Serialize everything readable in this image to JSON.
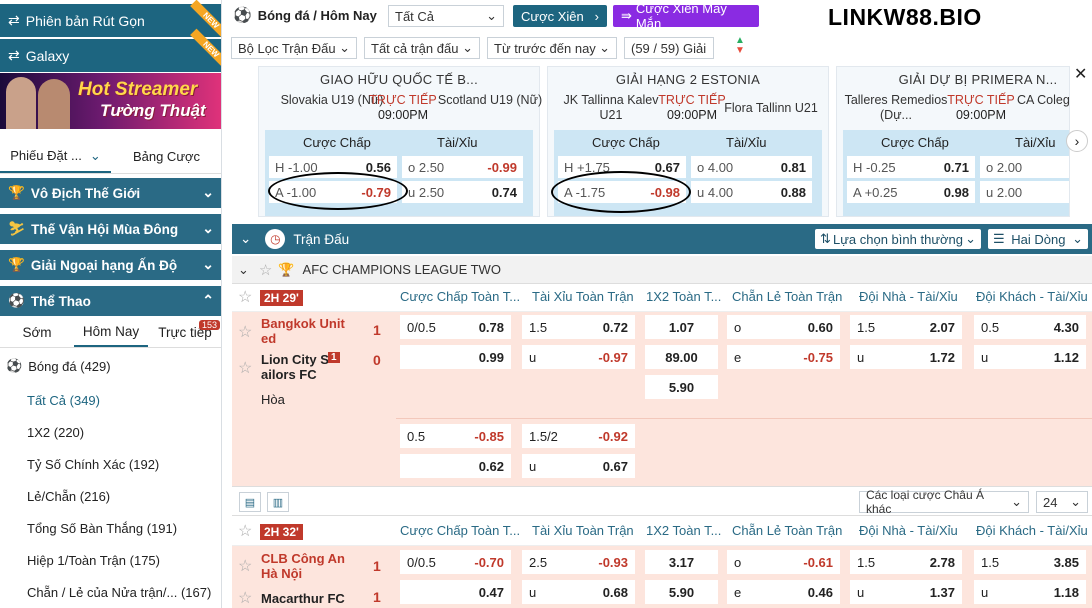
{
  "sidebar": {
    "collapsed_version": "Phiên bản Rút Gọn",
    "galaxy": "Galaxy",
    "new_tag": "NEW",
    "banner_line1": "Hot Streamer",
    "banner_line2": "Tường Thuật",
    "tab_slip": "Phiếu Đặt ...",
    "tab_table": "Bảng Cược",
    "categories": [
      {
        "label": "Vô Địch Thế Giới"
      },
      {
        "label": "Thế Vận Hội Mùa Đông"
      },
      {
        "label": "Giải Ngoại hạng Ấn Độ"
      },
      {
        "label": "Thể Thao"
      }
    ],
    "subtabs": [
      "Sớm",
      "Hôm Nay",
      "Trực tiếp"
    ],
    "live_count": "153",
    "sports": [
      {
        "label": "Bóng đá",
        "count": "(429)"
      },
      {
        "label": "Tất Cả",
        "count": "(349)"
      },
      {
        "label": "1X2",
        "count": "(220)"
      },
      {
        "label": "Tỷ Số Chính Xác",
        "count": "(192)"
      },
      {
        "label": "Lẻ/Chẵn",
        "count": "(216)"
      },
      {
        "label": "Tổng Số Bàn Thắng",
        "count": "(191)"
      },
      {
        "label": "Hiệp 1/Toàn Trận",
        "count": "(175)"
      },
      {
        "label": "Chẵn / Lẻ của Nửa trận/...",
        "count": "(167)"
      }
    ]
  },
  "toolbar": {
    "breadcrumb": "Bóng đá / Hôm Nay",
    "filter_all": "Tất Cả",
    "parlay": "Cược Xiên",
    "lucky_parlay": "Cược Xiên May Mắn",
    "brand": "LINKW88.BIO",
    "league_filter": "Bộ Lọc Trận Đấu",
    "all_matches": "Tất cả trận đấu",
    "time_filter": "Từ trước đến nay",
    "league_count": "(59 / 59) Giải"
  },
  "cards": [
    {
      "league": "GIAO HỮU QUỐC TẾ B...",
      "home": "Slovakia U19 (Nữ)",
      "away": "Scotland U19 (Nữ)",
      "live": "TRỰC TIẾP",
      "time": "09:00PM",
      "h_line": "-1.00",
      "h_odds": "0.56",
      "a_line": "-1.00",
      "a_odds": "-0.79",
      "o_line": "2.50",
      "o_odds": "-0.99",
      "u_line": "2.50",
      "u_odds": "0.74"
    },
    {
      "league": "GIẢI HẠNG 2 ESTONIA",
      "home": "JK Tallinna Kalev U21",
      "away": "Flora Tallinn U21",
      "live": "TRỰC TIẾP",
      "time": "09:00PM",
      "h_line": "+1.75",
      "h_odds": "0.67",
      "a_line": "-1.75",
      "a_odds": "-0.98",
      "o_line": "4.00",
      "o_odds": "0.81",
      "u_line": "4.00",
      "u_odds": "0.88"
    },
    {
      "league": "GIẢI DỰ BỊ PRIMERA N...",
      "home": "Talleres Remedios (Dự...",
      "away": "CA Coleg (R)",
      "live": "TRỰC TIẾP",
      "time": "09:00PM",
      "h_line": "-0.25",
      "h_odds": "0.71",
      "a_line": "+0.25",
      "a_odds": "0.98",
      "o_line": "2.00",
      "o_odds": "",
      "u_line": "2.00",
      "u_odds": ""
    }
  ],
  "card_labels": {
    "handicap": "Cược Chấp",
    "overunder": "Tài/Xỉu",
    "h": "H",
    "a": "A",
    "o": "o",
    "u": "u"
  },
  "section": {
    "title": "Trận Đấu",
    "view_select": "Lựa chọn bình thường",
    "rows_select": "Hai Dòng"
  },
  "league": "AFC CHAMPIONS LEAGUE TWO",
  "columns": [
    "Cược Chấp Toàn T...",
    "Tài Xỉu Toàn Trận",
    "1X2 Toàn T...",
    "Chẵn Lẻ Toàn Trận",
    "Đội Nhà - Tài/Xỉu",
    "Đội Khách - Tài/Xỉu"
  ],
  "match1": {
    "time": "2H 29'",
    "home": "Bangkok Unit ed",
    "home_score": "1",
    "away": "Lion City S ailors FC",
    "away_score": "0",
    "red_card": "1",
    "draw": "Hòa",
    "row1": {
      "hdp": "0/0.5",
      "hdp_o": "0.78",
      "ou": "1.5",
      "ou_o": "0.72",
      "x12": "1.07",
      "oe": "o",
      "oe_o": "0.60",
      "hm": "1.5",
      "hm_o": "2.07",
      "aw": "0.5",
      "aw_o": "4.30"
    },
    "row2": {
      "hdp_o": "0.99",
      "ou": "u",
      "ou_o": "-0.97",
      "x12": "89.00",
      "oe": "e",
      "oe_o": "-0.75",
      "hm": "u",
      "hm_o": "1.72",
      "aw": "u",
      "aw_o": "1.12"
    },
    "row3": {
      "x12": "5.90"
    },
    "row4": {
      "hdp": "0.5",
      "hdp_o": "-0.85",
      "ou": "1.5/2",
      "ou_o": "-0.92"
    },
    "row5": {
      "hdp_o": "0.62",
      "ou": "u",
      "ou_o": "0.67"
    }
  },
  "footer": {
    "market_select": "Các loại cược Châu Á khác",
    "page_size": "24"
  },
  "match2": {
    "time": "2H 32'",
    "home": "CLB Công An Hà Nội",
    "home_score": "1",
    "away": "Macarthur FC",
    "away_score": "1",
    "row1": {
      "hdp": "0/0.5",
      "hdp_o": "-0.70",
      "ou": "2.5",
      "ou_o": "-0.93",
      "x12": "3.17",
      "oe": "o",
      "oe_o": "-0.61",
      "hm": "1.5",
      "hm_o": "2.78",
      "aw": "1.5",
      "aw_o": "3.85"
    },
    "row2": {
      "hdp_o": "0.47",
      "ou": "u",
      "ou_o": "0.68",
      "x12": "5.90",
      "oe": "e",
      "oe_o": "0.46",
      "hm": "u",
      "hm_o": "1.37",
      "aw": "u",
      "aw_o": "1.18"
    }
  }
}
